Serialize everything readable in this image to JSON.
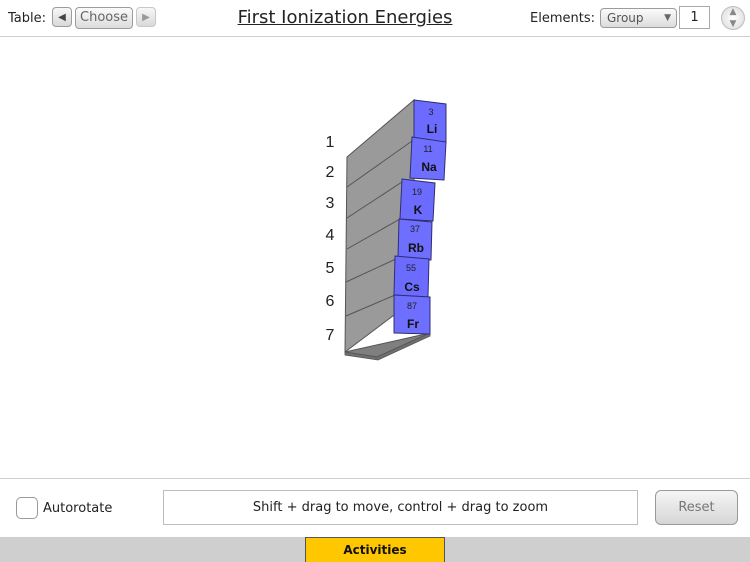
{
  "toolbar": {
    "table_label": "Table:",
    "prev_icon": "triangle-left-icon",
    "choose_label": "Choose",
    "next_icon": "triangle-right-icon",
    "title": "First Ionization Energies",
    "elements_label": "Elements:",
    "elements_select_value": "Group",
    "elements_number": "1"
  },
  "scene": {
    "period_labels": [
      "1",
      "2",
      "3",
      "4",
      "5",
      "6",
      "7"
    ],
    "elements": [
      {
        "number": "3",
        "symbol": "Li"
      },
      {
        "number": "11",
        "symbol": "Na"
      },
      {
        "number": "19",
        "symbol": "K"
      },
      {
        "number": "37",
        "symbol": "Rb"
      },
      {
        "number": "55",
        "symbol": "Cs"
      },
      {
        "number": "87",
        "symbol": "Fr"
      }
    ],
    "colors": {
      "face": "#7b7bff",
      "face_border": "#3c3c8a",
      "slab_side": "#8d8d8d",
      "slab_top": "#b8b8b8"
    }
  },
  "controls": {
    "autorotate_label": "Autorotate",
    "hint": "Shift + drag to move, control + drag to zoom",
    "reset_label": "Reset"
  },
  "footer": {
    "activities_label": "Activities",
    "accent": "#ffc700"
  }
}
